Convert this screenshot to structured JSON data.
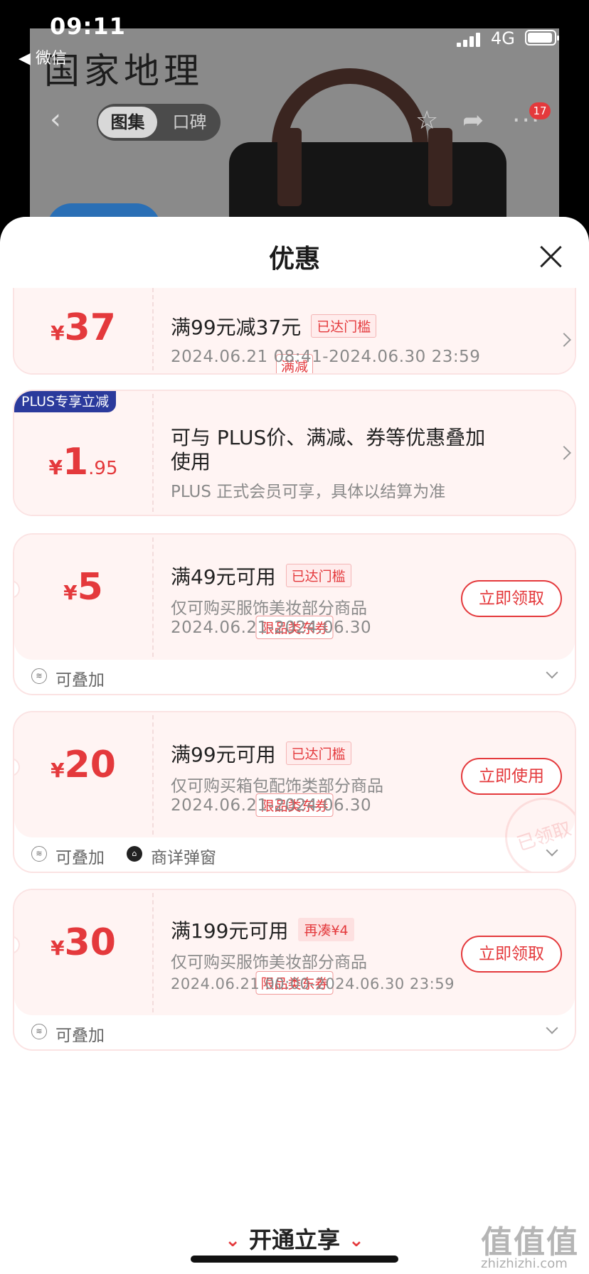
{
  "status_bar": {
    "time": "09:11",
    "back_app": "◀ 微信",
    "network": "4G"
  },
  "product_page": {
    "brand": "国家地理",
    "tabs": [
      "图集",
      "口碑"
    ],
    "active_tab": 0,
    "message_count": "17"
  },
  "sheet": {
    "title": "优惠"
  },
  "promos": [
    {
      "yen": "¥",
      "amount": "37",
      "type": "满减",
      "title": "满99元减37元",
      "tag": "已达门槛",
      "date": "2024.06.21 08:41-2024.06.30 23:59"
    },
    {
      "badge": "PLUS专享立减",
      "yen": "¥",
      "amount": "1",
      "cents": ".95",
      "title_line1": "可与 PLUS价、满减、券等优惠叠加",
      "title_line2": "使用",
      "desc": "PLUS 正式会员可享，具体以结算为准"
    }
  ],
  "coupons": [
    {
      "yen": "¥",
      "amount": "5",
      "type": "限品类东券",
      "title": "满49元可用",
      "tag": "已达门槛",
      "desc": "仅可购买服饰美妆部分商品",
      "date": "2024.06.21-2024.06.30",
      "button": "立即领取",
      "footer": "可叠加"
    },
    {
      "yen": "¥",
      "amount": "20",
      "type": "限品类东券",
      "title": "满99元可用",
      "tag": "已达门槛",
      "desc": "仅可购买箱包配饰类部分商品",
      "date": "2024.06.21-2024.06.30",
      "button": "立即使用",
      "footer": "可叠加",
      "footer2": "商详弹窗",
      "stamp": "已领取"
    },
    {
      "yen": "¥",
      "amount": "30",
      "type": "限品类东券",
      "title": "满199元可用",
      "tag": "再凑¥4",
      "desc": "仅可购买服饰美妆部分商品",
      "date": "2024.06.21 00:00-2024.06.30 23:59",
      "button": "立即领取",
      "footer": "可叠加"
    }
  ],
  "bottom": {
    "cta": "开通立享"
  },
  "watermark": {
    "logo": "值值值",
    "url": "zhizhizhi.com"
  },
  "colors": {
    "accent": "#e4393c",
    "plus_badge": "#2b3a9c",
    "card_bg": "#fff4f3"
  }
}
